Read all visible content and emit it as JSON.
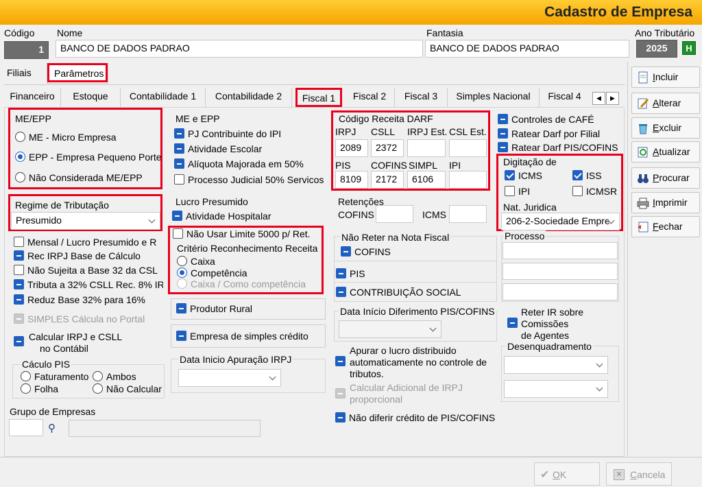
{
  "window": {
    "title": "Cadastro de Empresa"
  },
  "header": {
    "codigo_label": "Código",
    "codigo_value": "1",
    "nome_label": "Nome",
    "nome_value": "BANCO DE DADOS PADRAO",
    "fantasia_label": "Fantasia",
    "fantasia_value": "BANCO DE DADOS PADRAO",
    "ano_label": "Ano Tributário",
    "ano_value": "2025",
    "ano_btn": "H"
  },
  "main_tabs": [
    "Filiais",
    "Parâmetros"
  ],
  "sub_tabs": [
    "Financeiro",
    "Estoque",
    "Contabilidade 1",
    "Contabilidade 2",
    "Fiscal 1",
    "Fiscal 2",
    "Fiscal 3",
    "Simples Nacional",
    "Fiscal 4"
  ],
  "me_epp": {
    "title": "ME/EPP",
    "options": [
      "ME - Micro Empresa",
      "EPP - Empresa Pequeno Porte",
      "Não Considerada ME/EPP"
    ],
    "selected": "EPP - Empresa Pequeno Porte"
  },
  "regime": {
    "label": "Regime de Tributação",
    "value": "Presumido"
  },
  "left_checks": [
    {
      "label": "Mensal / Lucro Presumido e R",
      "state": "off"
    },
    {
      "label": "Rec IRPJ Base de Cálculo",
      "state": "blue"
    },
    {
      "label": "Não Sujeita a Base 32 da CSL",
      "state": "off"
    },
    {
      "label": "Tributa a 32% CSLL Rec. 8% IR",
      "state": "blue"
    },
    {
      "label": "Reduz Base 32% para 16%",
      "state": "blue"
    },
    {
      "label": "SIMPLES Cálcula  no Portal",
      "state": "grey"
    }
  ],
  "calc_irpj": {
    "line1": "Calcular IRPJ e CSLL",
    "line2": "no Contábil"
  },
  "calculo_pis": {
    "title": "Cáculo PIS",
    "options": [
      "Faturamento",
      "Ambos",
      "Folha",
      "Não Calcular"
    ]
  },
  "grupo": {
    "label": "Grupo de Empresas"
  },
  "me_e_epp": {
    "title": "ME e EPP",
    "items": [
      {
        "label": "PJ Contribuinte do IPI",
        "state": "blue"
      },
      {
        "label": "Atividade Escolar",
        "state": "blue"
      },
      {
        "label": "Alíquota Majorada em 50%",
        "state": "blue"
      },
      {
        "label": "Processo Judicial 50% Servicos",
        "state": "off"
      }
    ]
  },
  "lucro_presumido": {
    "title": "Lucro Presumido",
    "atividade": "Atividade Hospitalar",
    "nao_usar": "Não Usar Limite 5000 p/ Ret.",
    "criterio": "Critério Reconhecimento  Receita",
    "options": [
      "Caixa",
      "Competência",
      "Caixa / Como competência"
    ],
    "selected": "Competência"
  },
  "produtor_rural": "Produtor Rural",
  "empresa_simples": "Empresa de simples crédito",
  "data_apuracao": {
    "label": "Data Inicio Apuração IRPJ"
  },
  "darf": {
    "title": "Código Receita DARF",
    "labels1": [
      "IRPJ",
      "CSLL",
      "IRPJ Est.",
      "CSL Est."
    ],
    "values1": [
      "2089",
      "2372",
      "",
      ""
    ],
    "labels2": [
      "PIS",
      "COFINS",
      "SIMPL",
      "IPI"
    ],
    "values2": [
      "8109",
      "2172",
      "6106",
      ""
    ]
  },
  "retencoes": {
    "title": "Retenções",
    "cofins": "COFINS",
    "icms": "ICMS"
  },
  "nao_reter": {
    "title": "Não Reter na Nota Fiscal",
    "items": [
      "COFINS",
      "PIS",
      "CONTRIBUIÇÃO SOCIAL"
    ]
  },
  "diferimento": {
    "label": "Data Início Diferimento PIS/COFINS"
  },
  "apurar": {
    "line1": "Apurar o lucro distribuido",
    "line2": "automaticamente no controle de",
    "line3": "tributos."
  },
  "calcular_adicional": {
    "line1": "Calcular Adicional de IRPJ",
    "line2": "proporcional"
  },
  "nao_diferir": "Não diferir crédito de  PIS/COFINS",
  "right_checks": [
    "Controles de CAFÉ",
    "Ratear Darf por Filial",
    "Ratear Darf PIS/COFINS"
  ],
  "digitacao": {
    "title": "Digitação de",
    "items": [
      {
        "label": "ICMS",
        "checked": true
      },
      {
        "label": "ISS",
        "checked": true
      },
      {
        "label": "IPI",
        "checked": false
      },
      {
        "label": "ICMSR",
        "checked": false
      }
    ],
    "nat_label": "Nat. Juridica",
    "nat_value": "206-2-Sociedade Empre"
  },
  "processo": {
    "label": "Processo"
  },
  "reter_ir": {
    "line1": "Reter IR sobre",
    "line2": "Comissões",
    "line3": "de Agentes"
  },
  "desenquadramento": {
    "label": "Desenquadramento"
  },
  "buttons": [
    {
      "label": "Incluir",
      "ul": "I",
      "rest": "ncluir"
    },
    {
      "label": "Alterar",
      "ul": "A",
      "rest": "lterar"
    },
    {
      "label": "Excluir",
      "ul": "E",
      "rest": "xcluir"
    },
    {
      "label": "Atualizar",
      "ul": "A",
      "rest": "tualizar"
    },
    {
      "label": "Procurar",
      "ul": "P",
      "rest": "rocurar"
    },
    {
      "label": "Imprimir",
      "ul": "I",
      "rest": "mprimir"
    },
    {
      "label": "Fechar",
      "ul": "F",
      "rest": "echar"
    }
  ],
  "footer": {
    "ok_ul": "O",
    "ok_rest": "K",
    "cancel_ul": "C",
    "cancel_rest": "ancela"
  },
  "colors": {
    "accent": "#1f5fbf",
    "highlight": "#e8001c",
    "title_bg": "#f5a500"
  }
}
